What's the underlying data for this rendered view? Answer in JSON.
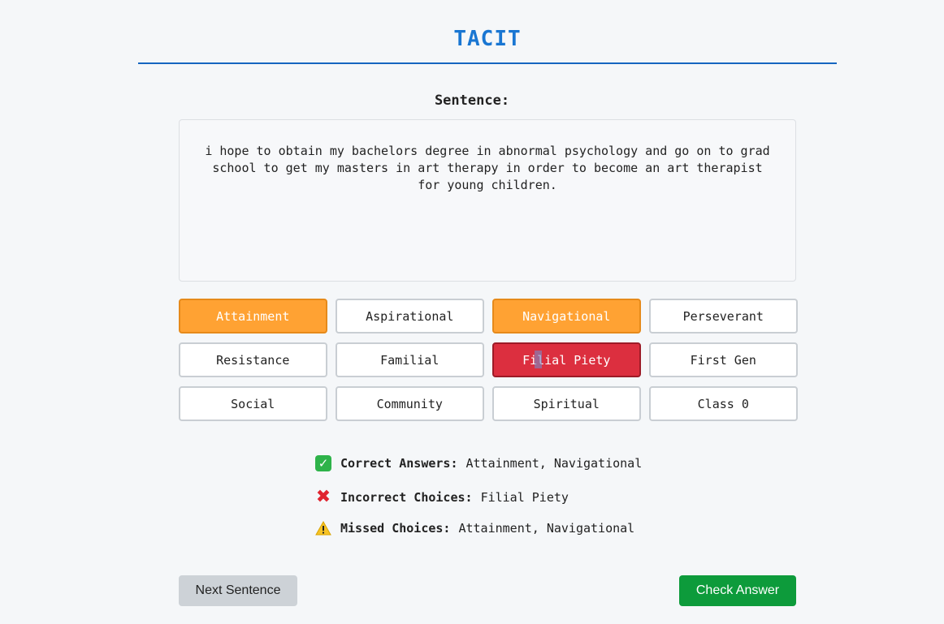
{
  "app": {
    "title": "TACIT"
  },
  "sentence": {
    "label": "Sentence:",
    "text": "i hope to obtain my bachelors degree in abnormal psychology and go on to grad school to get my masters in art therapy in order to become an art therapist for young children."
  },
  "options": [
    {
      "label": "Attainment",
      "state": "correct"
    },
    {
      "label": "Aspirational",
      "state": "default"
    },
    {
      "label": "Navigational",
      "state": "correct"
    },
    {
      "label": "Perseverant",
      "state": "default"
    },
    {
      "label": "Resistance",
      "state": "default"
    },
    {
      "label": "Familial",
      "state": "default"
    },
    {
      "label": "Filial Piety",
      "state": "incorrect"
    },
    {
      "label": "First Gen",
      "state": "default"
    },
    {
      "label": "Social",
      "state": "default"
    },
    {
      "label": "Community",
      "state": "default"
    },
    {
      "label": "Spiritual",
      "state": "default"
    },
    {
      "label": "Class 0",
      "state": "default"
    }
  ],
  "results": {
    "correct": {
      "icon": "check-mark-icon",
      "label": "Correct Answers:",
      "value": "Attainment, Navigational"
    },
    "incorrect": {
      "icon": "cross-mark-icon",
      "label": "Incorrect Choices:",
      "value": "Filial Piety"
    },
    "missed": {
      "icon": "warning-icon",
      "label": "Missed Choices:",
      "value": "Attainment, Navigational"
    }
  },
  "buttons": {
    "next": "Next Sentence",
    "check": "Check Answer"
  },
  "colors": {
    "accent": "#1976d2",
    "selected_correct": "#ffa233",
    "selected_incorrect": "#dc2f3f",
    "check_button": "#0d9b3b"
  }
}
